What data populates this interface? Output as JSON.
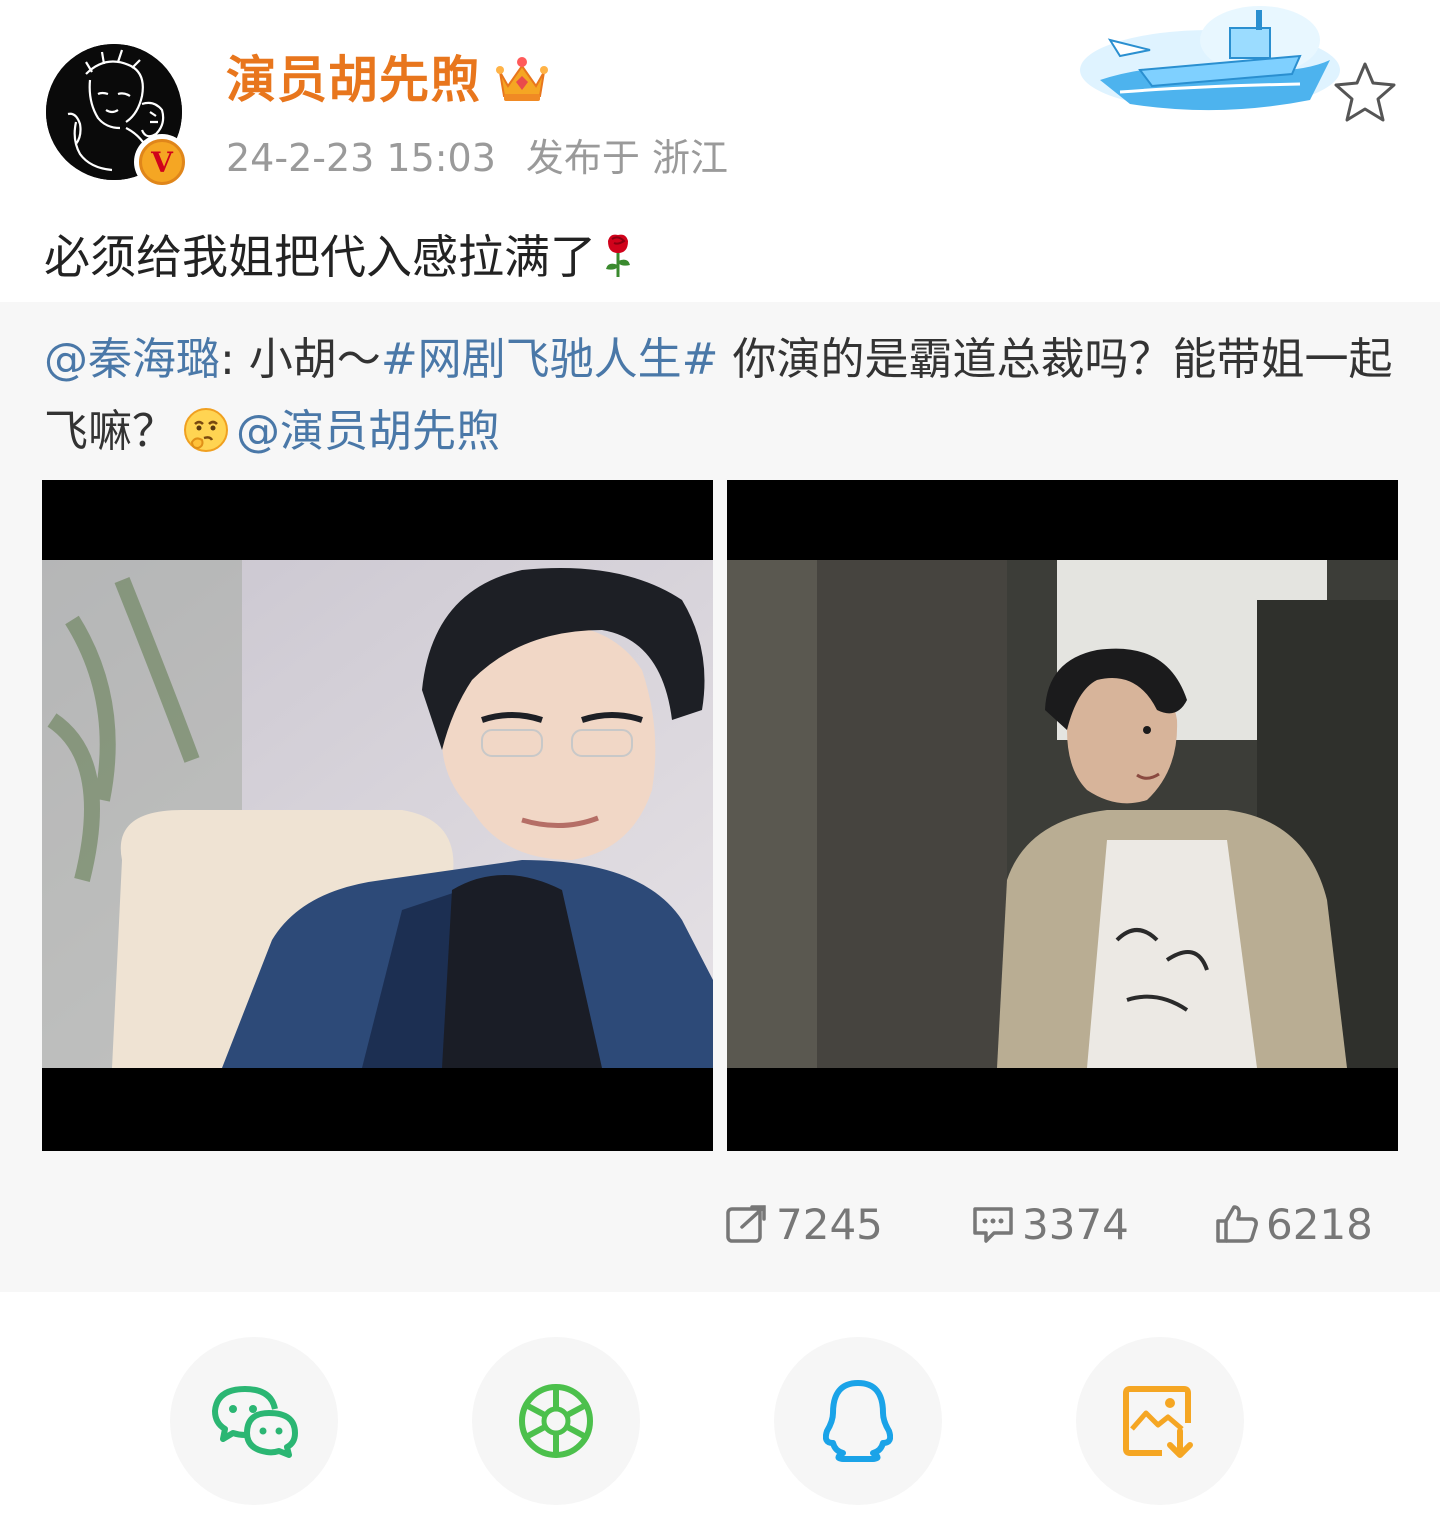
{
  "post": {
    "author": "演员胡先煦",
    "timestamp": "24-2-23 15:03",
    "location": "发布于 浙江",
    "text": "必须给我姐把代入感拉满了",
    "icons": [
      "verified-badge-icon",
      "crown-member-icon",
      "rose-emoji-icon",
      "favorite-star-icon"
    ]
  },
  "repost": {
    "mention": "@秦海璐",
    "colon": ": 小胡～",
    "hashtag": "#网剧飞驰人生#",
    "body": " 你演的是霸道总裁吗？能带姐一起飞嘛？",
    "end_mention": "@演员胡先煦",
    "images": [
      "video-still-suit-glasses",
      "video-still-casual-shirt"
    ]
  },
  "stats": {
    "reposts": "7245",
    "comments": "3374",
    "likes": "6218"
  },
  "share": {
    "icons": [
      "wechat-icon",
      "moments-icon",
      "qq-icon",
      "save-image-icon"
    ]
  },
  "colors": {
    "username": "#e8761d",
    "link": "#4a78a8",
    "repost_bg": "#f7f7f7",
    "wechat": "#2bb673",
    "moments": "#4cc04c",
    "qq": "#1aa3e8",
    "save": "#f5a623"
  }
}
